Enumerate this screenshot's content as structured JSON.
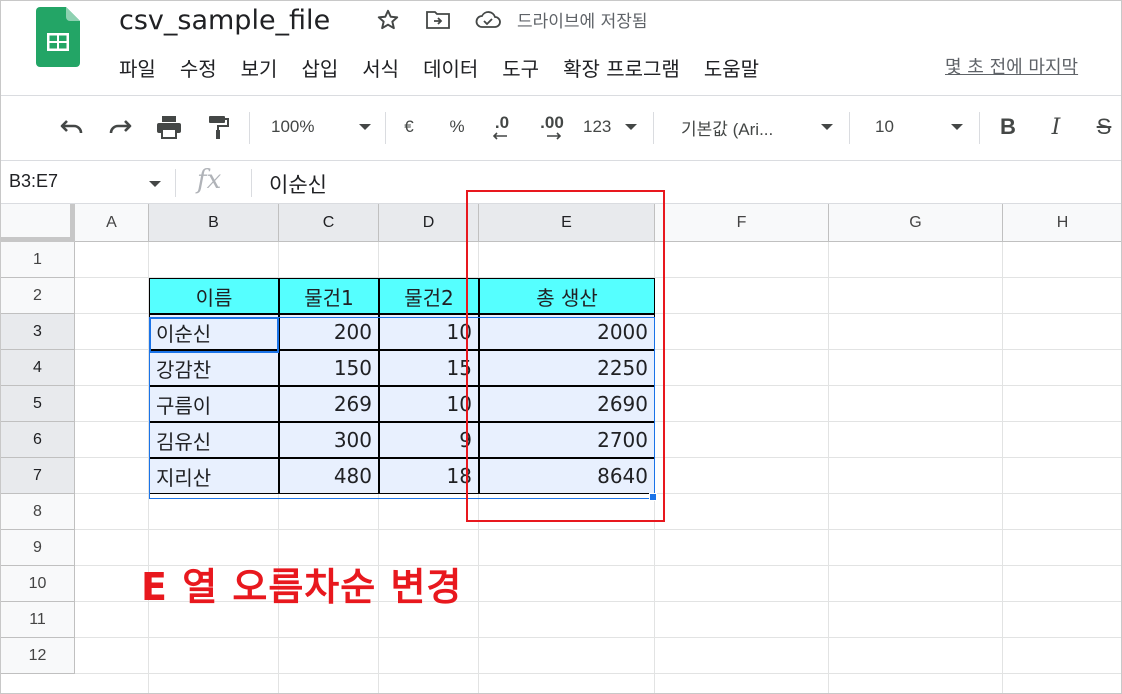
{
  "header": {
    "doc_title": "csv_sample_file",
    "save_status": "드라이브에 저장됨",
    "last_edit": "몇 초 전에 마지막",
    "menu": [
      "파일",
      "수정",
      "보기",
      "삽입",
      "서식",
      "데이터",
      "도구",
      "확장 프로그램",
      "도움말"
    ]
  },
  "toolbar": {
    "zoom": "100%",
    "currency": "€",
    "percent": "%",
    "dec_decrease": ".0",
    "dec_increase": ".00",
    "number_format": "123",
    "font": "기본값 (Ari...",
    "font_size": "10",
    "bold": "B",
    "italic": "I",
    "strike": "S"
  },
  "formula_bar": {
    "name_box": "B3:E7",
    "fx": "fx",
    "value": "이순신"
  },
  "grid": {
    "columns": [
      "A",
      "B",
      "C",
      "D",
      "E",
      "F",
      "G",
      "H"
    ],
    "rows": [
      "1",
      "2",
      "3",
      "4",
      "5",
      "6",
      "7",
      "8",
      "9",
      "10",
      "11",
      "12"
    ],
    "selected_columns": [
      "B",
      "C",
      "D",
      "E"
    ],
    "selected_rows": [
      "3",
      "4",
      "5",
      "6",
      "7"
    ]
  },
  "table": {
    "headers": [
      "이름",
      "물건1",
      "물건2",
      "총 생산"
    ],
    "rows": [
      [
        "이순신",
        "200",
        "10",
        "2000"
      ],
      [
        "강감찬",
        "150",
        "15",
        "2250"
      ],
      [
        "구름이",
        "269",
        "10",
        "2690"
      ],
      [
        "김유신",
        "300",
        "9",
        "2700"
      ],
      [
        "지리산",
        "480",
        "18",
        "8640"
      ]
    ]
  },
  "annotation": "E 열 오름차순 변경",
  "colors": {
    "header_fill": "#55ffff",
    "selection_fill": "#e8f0fe",
    "selection_blue": "#1a73e8",
    "annotation_red": "#e8181e"
  },
  "icons": [
    "sheets-logo-icon",
    "star-icon",
    "move-folder-icon",
    "cloud-saved-icon",
    "undo-icon",
    "redo-icon",
    "print-icon",
    "paint-format-icon"
  ]
}
